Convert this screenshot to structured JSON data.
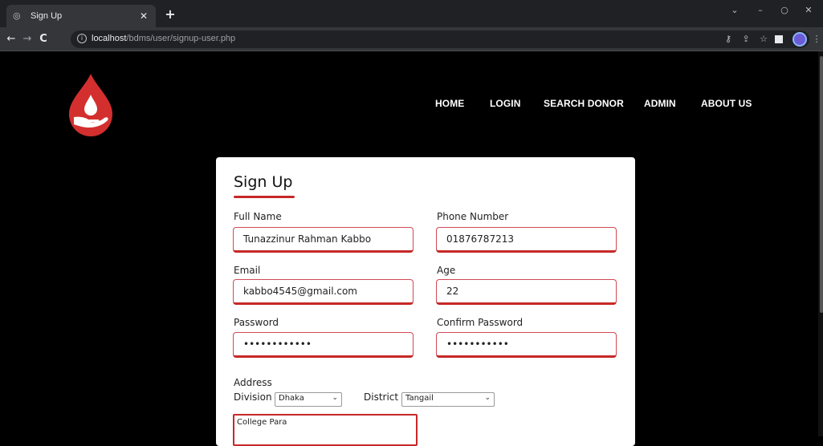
{
  "browser": {
    "tab_title": "Sign Up",
    "url_host": "localhost",
    "url_path": "/bdms/user/signup-user.php"
  },
  "site": {
    "nav": [
      "HOME",
      "LOGIN",
      "SEARCH DONOR",
      "ADMIN",
      "ABOUT US"
    ],
    "brand_color": "#c62828"
  },
  "form": {
    "title": "Sign Up",
    "full_name_label": "Full Name",
    "full_name_value": "Tunazzinur Rahman Kabbo",
    "phone_label": "Phone Number",
    "phone_value": "01876787213",
    "email_label": "Email",
    "email_value": "kabbo4545@gmail.com",
    "age_label": "Age",
    "age_value": "22",
    "password_label": "Password",
    "password_value": "••••••••••••",
    "confirm_password_label": "Confirm Password",
    "confirm_password_value": "•••••••••••",
    "address_label": "Address",
    "division_label": "Division",
    "division_value": "Dhaka",
    "district_label": "District",
    "district_value": "Tangail",
    "address_value": "College Para"
  }
}
